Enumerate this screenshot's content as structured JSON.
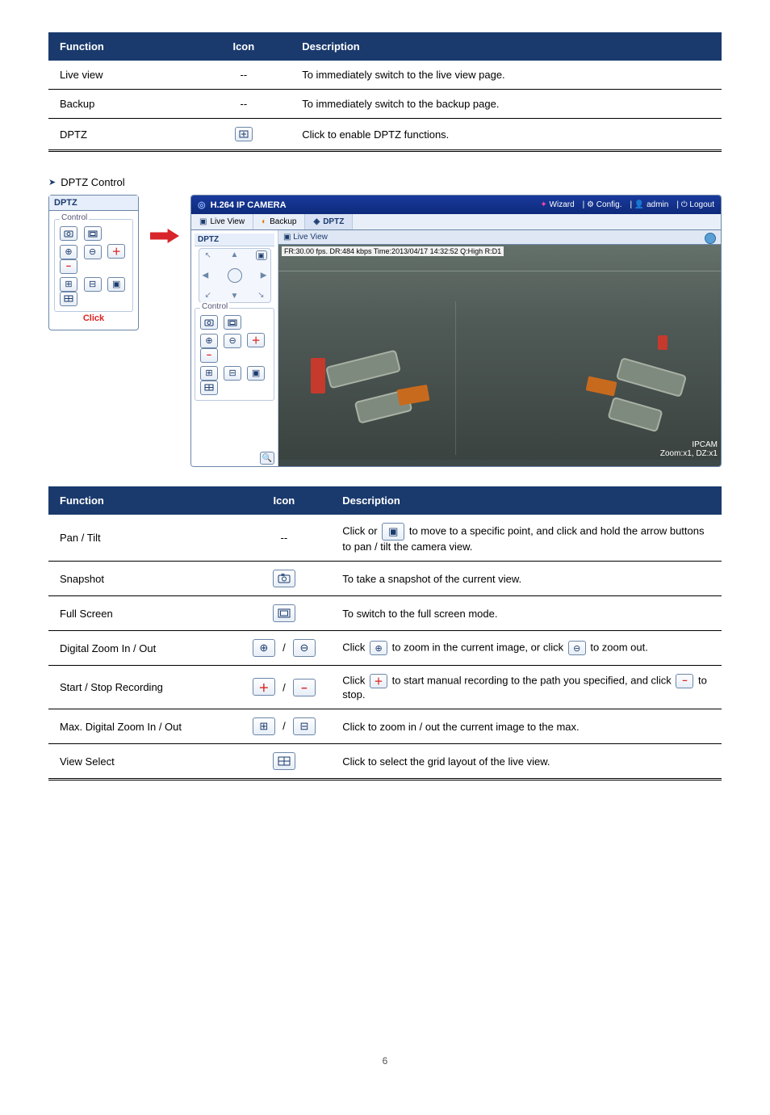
{
  "dptz_heading": "DPTZ Control",
  "table1": {
    "headers": {
      "function": "Function",
      "icon": "Icon",
      "desc": "Description"
    },
    "rows": [
      {
        "fn": "Live view",
        "desc": "To immediately switch to the live view page."
      },
      {
        "fn": "Backup",
        "desc": "To immediately switch to the backup page."
      },
      {
        "fn": "DPTZ",
        "desc": "Click to enable DPTZ functions."
      }
    ]
  },
  "mini_panel": {
    "title": "DPTZ",
    "group": "Control",
    "click": "Click"
  },
  "app": {
    "title": "H.264 IP CAMERA",
    "top_links": {
      "wizard": "Wizard",
      "config": "Config.",
      "user": "admin",
      "logout": "Logout"
    },
    "tabs": {
      "liveview": "Live View",
      "backup": "Backup",
      "dptz": "DPTZ"
    },
    "view_tab": "Live View",
    "side_group": "Control",
    "osd": "FR:30.00 fps. DR:484 kbps Time:2013/04/17 14:32:52 Q:High R:D1",
    "watermark_line1": "IPCAM",
    "watermark_line2": "Zoom:x1, DZ:x1"
  },
  "table2": {
    "headers": {
      "function": "Function",
      "icon": "Icon",
      "desc": "Description"
    },
    "rows": [
      {
        "fn": "Pan / Tilt",
        "desc_pre": "Click or ",
        "desc_post": " to move to a specific point, and click and hold the arrow buttons to pan / tilt the camera view."
      },
      {
        "fn": "Snapshot",
        "desc": "To take a snapshot of the current view."
      },
      {
        "fn": "Full Screen",
        "desc": "To switch to the full screen mode."
      },
      {
        "fn": "Digital Zoom In / Out",
        "desc_pre": "Click ",
        "desc_mid": " to zoom in the current image, or click ",
        "desc_post": " to zoom out."
      },
      {
        "fn": "Start / Stop Recording",
        "desc_pre": "Click ",
        "desc_mid": " to start manual recording to the path you specified, and click ",
        "desc_post": " to stop."
      },
      {
        "fn": "Max. Digital Zoom In / Out",
        "desc": "Click to zoom in / out the current image to the max."
      },
      {
        "fn": "View Select",
        "desc": "Click to select the grid layout of the live view."
      }
    ]
  },
  "page_number": "6"
}
